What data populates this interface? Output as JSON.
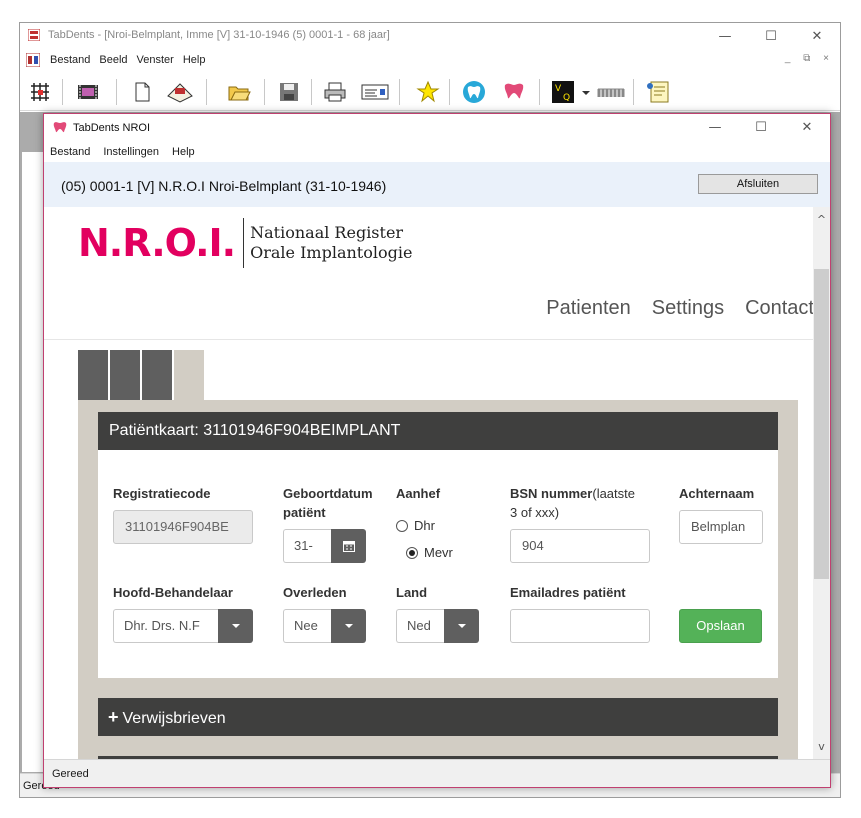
{
  "outer_window": {
    "title": "TabDents - [Nroi-Belmplant, Imme [V] 31-10-1946 (5) 0001-1 - 68 jaar]",
    "menu": [
      "Bestand",
      "Beeld",
      "Venster",
      "Help"
    ],
    "status": "Gereed"
  },
  "window_controls": {
    "minimize": "—",
    "maximize": "☐",
    "close": "✕"
  },
  "mdi_controls": "_ ⧉ ×",
  "toolbar_icons": [
    "grid-icon",
    "film-icon",
    "new-document-icon",
    "scanner-icon",
    "open-folder-icon",
    "save-icon",
    "print-icon",
    "card-icon",
    "star-icon",
    "tooth-blue-icon",
    "tooth-pink-icon",
    "vq-icon",
    "dropdown-icon",
    "teeth-row-icon",
    "notes-icon"
  ],
  "inner_window": {
    "title": "TabDents NROI",
    "menu": [
      "Bestand",
      "Instellingen",
      "Help"
    ],
    "patient_header": "(05) 0001-1 [V] N.R.O.I Nroi-Belmplant   (31-10-1946)",
    "close_button": "Afsluiten",
    "status": "Gereed"
  },
  "site": {
    "logo_text": "N.R.O.I.",
    "logo_line1": "Nationaal Register",
    "logo_line2": "Orale Implantologie",
    "nav": [
      "Patienten",
      "Settings",
      "Contact"
    ]
  },
  "card": {
    "title": "Patiëntkaart: 31101946F904BEIMPLANT",
    "registration_label": "Registratiecode",
    "registration_value": "31101946F904BE",
    "birthdate_label_1": "Geboortdatum",
    "birthdate_label_2": "patiënt",
    "birthdate_value": "31-",
    "salutation_label": "Aanhef",
    "salutation_options": [
      {
        "label": "Dhr",
        "selected": false
      },
      {
        "label": "Mevr",
        "selected": true
      }
    ],
    "bsn_label": "BSN nummer",
    "bsn_hint_1": "(laatste",
    "bsn_hint_2": "3 of xxx)",
    "bsn_value": "904",
    "lastname_label": "Achternaam",
    "lastname_value": "Belmplan",
    "practitioner_label": "Hoofd-Behandelaar",
    "practitioner_value": "Dhr. Drs. N.F",
    "deceased_label": "Overleden",
    "deceased_value": "Nee",
    "country_label": "Land",
    "country_value": "Ned",
    "email_label": "Emailadres patiënt",
    "email_value": "",
    "save_button": "Opslaan"
  },
  "panels": {
    "referrals": "Verwijsbrieven"
  },
  "colors": {
    "brand": "#e2005f",
    "dark_header": "#3f3f3e",
    "save": "#54b258",
    "tab_bg": "#d2cdc4"
  }
}
